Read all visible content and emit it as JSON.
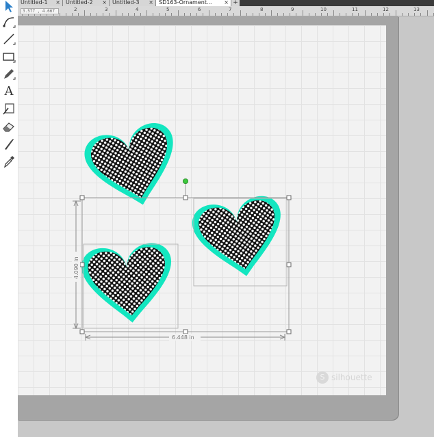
{
  "tabs": [
    {
      "label": "Untitled-1",
      "close": "×"
    },
    {
      "label": "Untitled-2",
      "close": "×"
    },
    {
      "label": "Untitled-3",
      "close": "×"
    },
    {
      "label": "SD163-Ornament...",
      "close": "×"
    }
  ],
  "new_tab": "+",
  "ruler": {
    "coordinate_readout": "3.577 , 4.667",
    "labels": [
      "2",
      "3",
      "4",
      "5",
      "6",
      "7",
      "8",
      "9",
      "10",
      "11",
      "12",
      "13"
    ]
  },
  "toolbar": {
    "tools": [
      "select-arrow-icon",
      "point-edit-icon",
      "line-icon",
      "rectangle-icon",
      "pencil-icon",
      "text-icon",
      "text-edit-icon",
      "eraser-icon",
      "knife-icon",
      "eyedropper-icon"
    ],
    "text_tool_glyph": "A"
  },
  "selection": {
    "height_label": "4.090 in",
    "width_label": "6.448 in"
  },
  "watermark": {
    "text": "silhouette"
  },
  "colors": {
    "heart_outline": "#13e6c0",
    "heart_fill": "#111111",
    "dots": "#ffffff",
    "selection_handle_rotate": "#3cc93c"
  }
}
